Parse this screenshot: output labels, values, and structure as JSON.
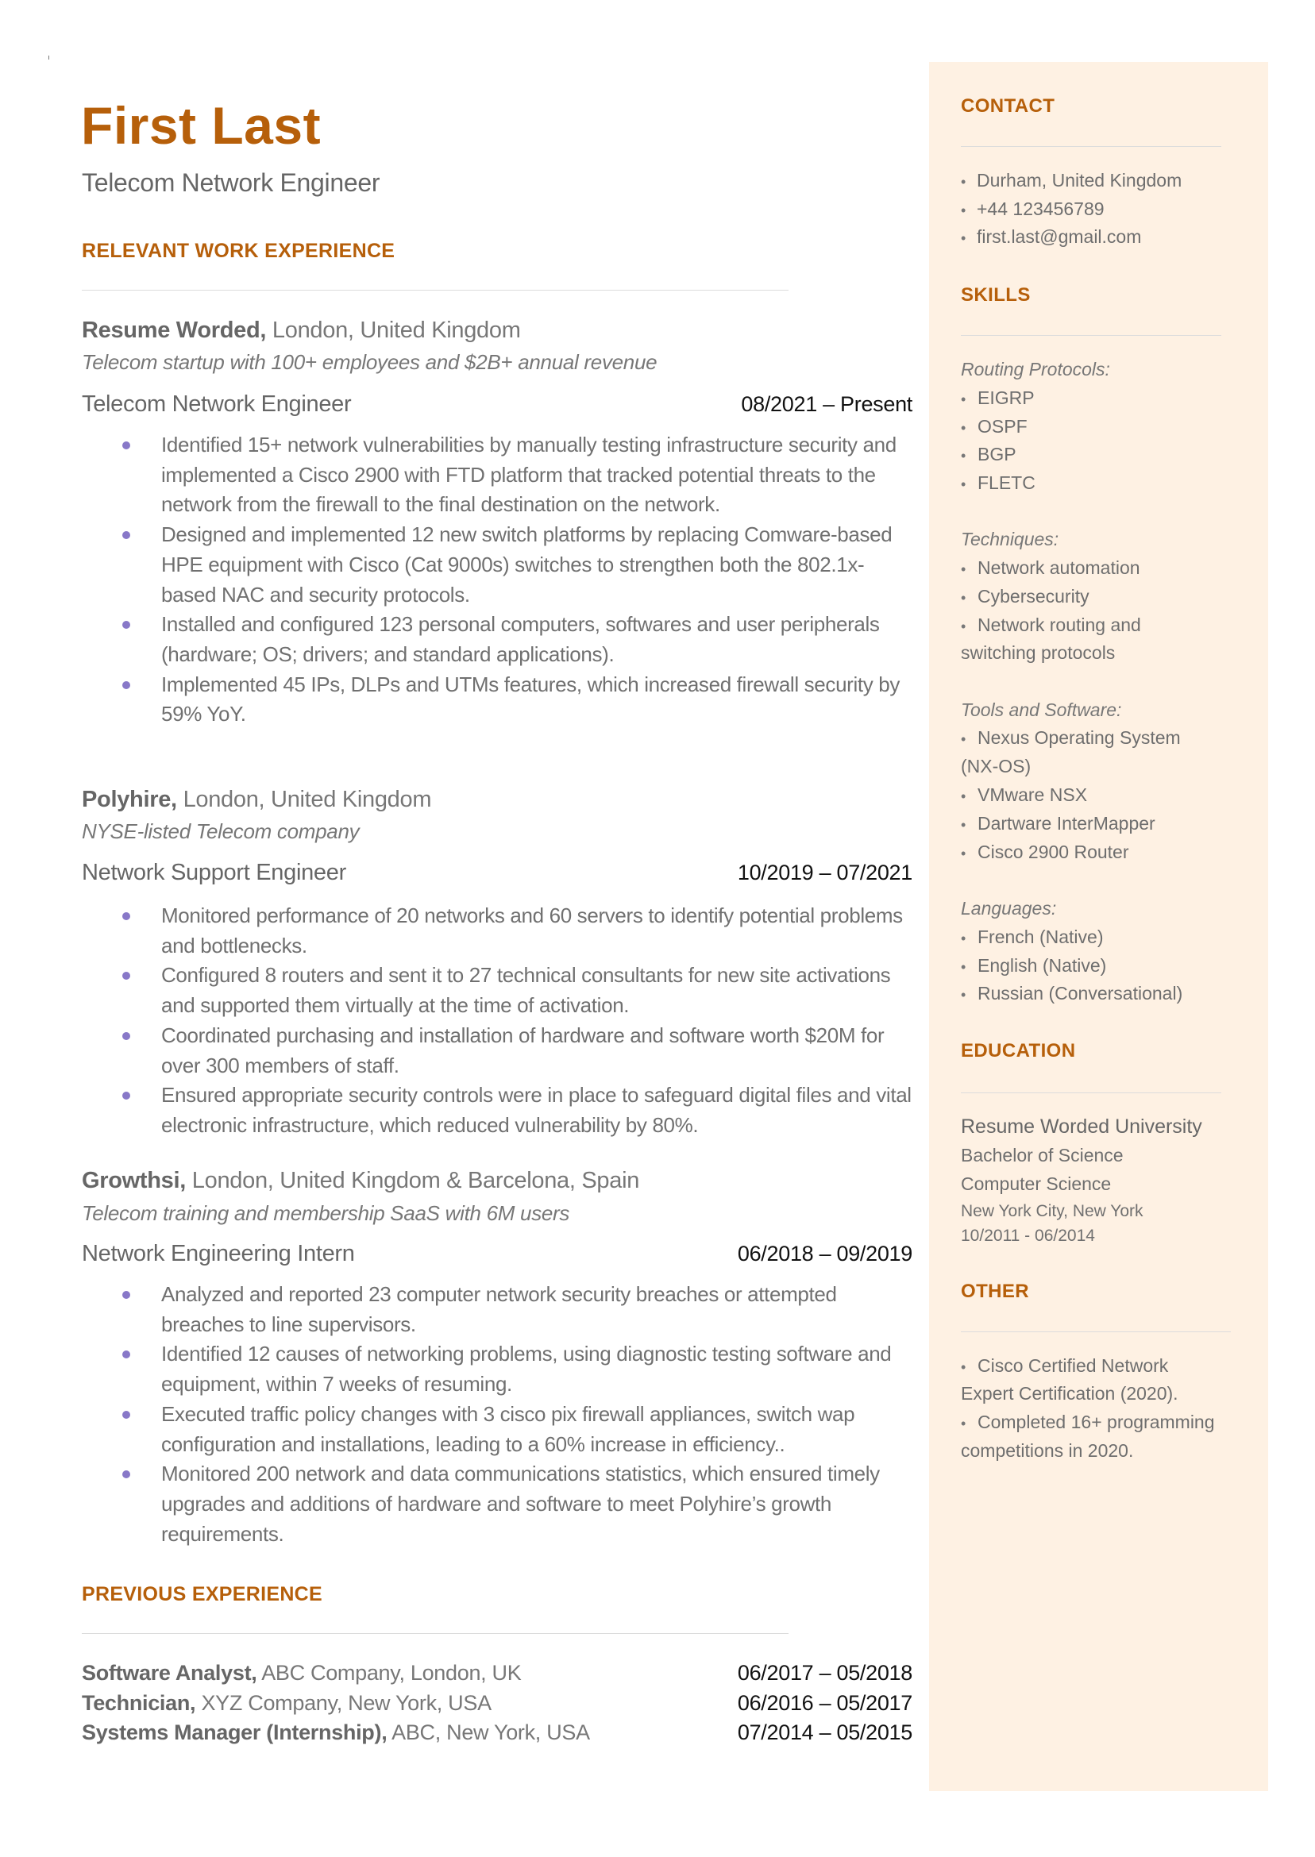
{
  "header": {
    "name": "First Last",
    "title": "Telecom Network Engineer"
  },
  "colors": {
    "accent": "#b65f0a",
    "sidebar_bg": "#fef1e3",
    "bullet": "#8878c8",
    "text": "#666666"
  },
  "relevant_experience": {
    "heading": "RELEVANT WORK EXPERIENCE",
    "jobs": [
      {
        "company": "Resume Worded,",
        "location": "London, United Kingdom",
        "tagline": "Telecom startup with 100+ employees and $2B+ annual revenue",
        "role": "Telecom Network Engineer",
        "dates": "08/2021 – Present",
        "bullets": [
          "Identified 15+ network vulnerabilities by manually testing infrastructure security and implemented a Cisco 2900 with FTD platform that tracked potential threats to the network from the firewall to the final destination on the network.",
          "Designed and implemented 12 new switch platforms by replacing Comware-based HPE equipment with Cisco (Cat 9000s) switches to strengthen both the 802.1x-based NAC and security protocols.",
          "Installed and configured 123 personal computers, softwares and user peripherals (hardware; OS; drivers; and standard applications).",
          "Implemented 45 IPs, DLPs and UTMs features, which increased firewall security by 59% YoY."
        ]
      },
      {
        "company": "Polyhire,",
        "location": "London, United Kingdom",
        "tagline": "NYSE-listed Telecom company",
        "role": "Network Support Engineer",
        "dates": "10/2019 – 07/2021",
        "bullets": [
          "Monitored performance of 20 networks and 60 servers to identify potential problems and bottlenecks.",
          "Configured 8 routers and sent it to 27 technical consultants for new site activations and supported them virtually at the time of activation.",
          "Coordinated purchasing and installation of hardware and software worth $20M for over 300 members of staff.",
          "Ensured appropriate security controls were in place to safeguard digital files and vital electronic infrastructure, which reduced vulnerability by 80%."
        ]
      },
      {
        "company": "Growthsi,",
        "location": "London, United Kingdom & Barcelona, Spain",
        "tagline": "Telecom training and membership SaaS with 6M users",
        "role": "Network Engineering Intern",
        "dates": "06/2018 – 09/2019",
        "bullets": [
          "Analyzed and reported 23 computer network security breaches or attempted breaches to line supervisors.",
          "Identified 12 causes of networking problems, using diagnostic testing software and equipment, within 7 weeks of resuming.",
          "Executed traffic policy changes with 3 cisco pix firewall appliances, switch wap configuration and installations, leading to a 60% increase in efficiency..",
          "Monitored 200 network and data communications statistics, which ensured timely upgrades and additions of hardware and software to meet Polyhire’s growth requirements."
        ]
      }
    ]
  },
  "previous_experience": {
    "heading": "PREVIOUS EXPERIENCE",
    "rows": [
      {
        "role": "Software Analyst,",
        "rest": "ABC Company, London, UK",
        "dates": "06/2017 – 05/2018"
      },
      {
        "role": "Technician,",
        "rest": "XYZ Company, New York, USA",
        "dates": "06/2016 – 05/2017"
      },
      {
        "role": "Systems Manager (Internship),",
        "rest": "ABC, New York, USA",
        "dates": "07/2014 – 05/2015"
      }
    ]
  },
  "sidebar": {
    "contact": {
      "heading": "CONTACT",
      "items": [
        "Durham, United Kingdom",
        "+44 123456789",
        "first.last@gmail.com"
      ]
    },
    "skills": {
      "heading": "SKILLS",
      "groups": [
        {
          "label": "Routing Protocols:",
          "items": [
            "EIGRP",
            "OSPF",
            "BGP",
            "FLETC"
          ]
        },
        {
          "label": "Techniques:",
          "items": [
            "Network automation",
            "Cybersecurity",
            "Network routing and",
            "switching protocols"
          ]
        },
        {
          "label": "Tools and Software:",
          "items": [
            "Nexus Operating System",
            "(NX-OS)",
            "VMware NSX",
            "Dartware InterMapper",
            "Cisco 2900 Router"
          ]
        },
        {
          "label": "Languages:",
          "items": [
            "French (Native)",
            "English (Native)",
            "Russian (Conversational)"
          ]
        }
      ]
    },
    "education": {
      "heading": "EDUCATION",
      "school": "Resume Worded University",
      "degree": "Bachelor of Science",
      "field": "Computer Science",
      "location": "New York City, New York",
      "dates": "10/2011 - 06/2014"
    },
    "other": {
      "heading": "OTHER",
      "lines": [
        "Cisco Certified Network",
        "Expert Certification (2020).",
        "Completed 16+ programming",
        "competitions in 2020."
      ]
    }
  }
}
